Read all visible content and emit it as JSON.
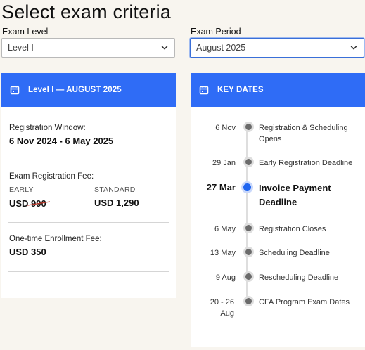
{
  "page": {
    "title": "Select exam criteria"
  },
  "exam_level": {
    "label": "Exam Level",
    "value": "Level I"
  },
  "exam_period": {
    "label": "Exam Period",
    "value": "August 2025"
  },
  "summary": {
    "header": "Level I — AUGUST 2025",
    "registration_window_label": "Registration Window:",
    "registration_window_value": "6 Nov 2024 - 6 May 2025",
    "fee_label": "Exam Registration Fee:",
    "early_label": "EARLY",
    "early_value": "USD 990",
    "standard_label": "STANDARD",
    "standard_value": "USD 1,290",
    "enrollment_label": "One-time Enrollment Fee:",
    "enrollment_value": "USD 350"
  },
  "key_dates": {
    "header": "KEY DATES",
    "items": [
      {
        "date": "6 Nov",
        "text": "Registration & Scheduling Opens"
      },
      {
        "date": "29 Jan",
        "text": "Early Registration Deadline"
      },
      {
        "date": "27 Mar",
        "text": "Invoice Payment Deadline",
        "highlight": true
      },
      {
        "date": "6 May",
        "text": "Registration Closes"
      },
      {
        "date": "13 May",
        "text": "Scheduling Deadline"
      },
      {
        "date": "9 Aug",
        "text": "Rescheduling Deadline"
      },
      {
        "date": "20 - 26 Aug",
        "text": "CFA Program Exam Dates"
      }
    ]
  },
  "colors": {
    "accent": "#2f6cf6",
    "highlight_dot": "#1f65f0",
    "strike": "#c0392b"
  },
  "icons": {
    "calendar": "calendar-icon",
    "chevron": "chevron-down-icon"
  }
}
